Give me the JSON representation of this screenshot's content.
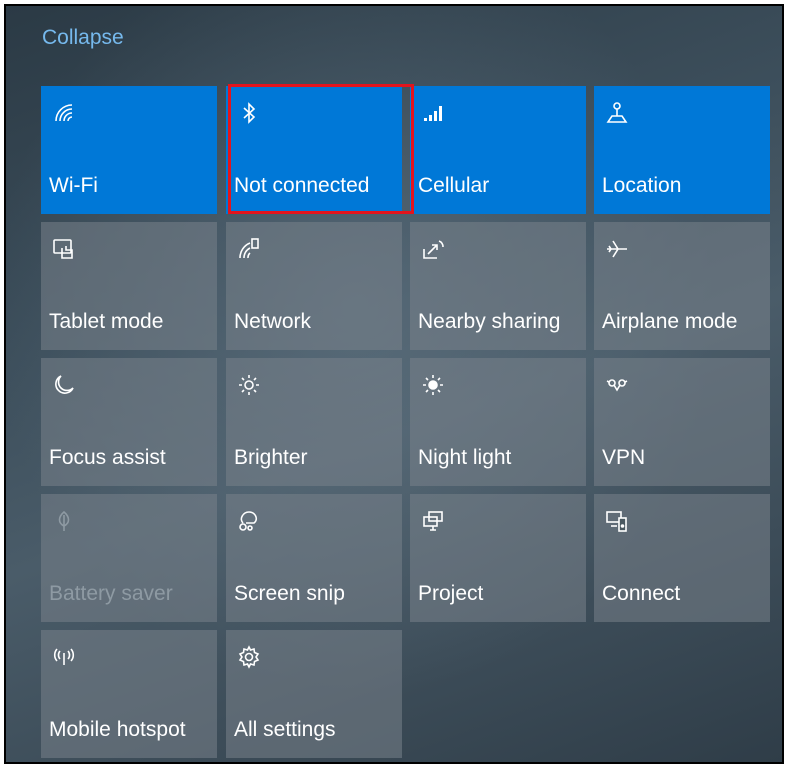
{
  "header": {
    "collapse_label": "Collapse"
  },
  "tiles": [
    {
      "label": "Wi-Fi",
      "icon": "wifi-icon",
      "state": "on"
    },
    {
      "label": "Not connected",
      "icon": "bluetooth-icon",
      "state": "on",
      "highlighted": true
    },
    {
      "label": "Cellular",
      "icon": "cellular-signal-icon",
      "state": "on"
    },
    {
      "label": "Location",
      "icon": "location-icon",
      "state": "on"
    },
    {
      "label": "Tablet mode",
      "icon": "tablet-mode-icon",
      "state": "off"
    },
    {
      "label": "Network",
      "icon": "network-icon",
      "state": "off"
    },
    {
      "label": "Nearby sharing",
      "icon": "nearby-sharing-icon",
      "state": "off"
    },
    {
      "label": "Airplane mode",
      "icon": "airplane-icon",
      "state": "off"
    },
    {
      "label": "Focus assist",
      "icon": "moon-icon",
      "state": "off"
    },
    {
      "label": "Brighter",
      "icon": "sun-icon",
      "state": "off"
    },
    {
      "label": "Night light",
      "icon": "night-light-icon",
      "state": "off"
    },
    {
      "label": "VPN",
      "icon": "vpn-icon",
      "state": "off"
    },
    {
      "label": "Battery saver",
      "icon": "battery-saver-leaf-icon",
      "state": "disabled"
    },
    {
      "label": "Screen snip",
      "icon": "scissors-icon",
      "state": "off"
    },
    {
      "label": "Project",
      "icon": "project-icon",
      "state": "off"
    },
    {
      "label": "Connect",
      "icon": "connect-icon",
      "state": "off"
    },
    {
      "label": "Mobile hotspot",
      "icon": "hotspot-icon",
      "state": "off"
    },
    {
      "label": "All settings",
      "icon": "gear-icon",
      "state": "off"
    }
  ],
  "colors": {
    "accent": "#0078d7",
    "highlight_border": "#e3141d",
    "link": "#76b9ed"
  }
}
